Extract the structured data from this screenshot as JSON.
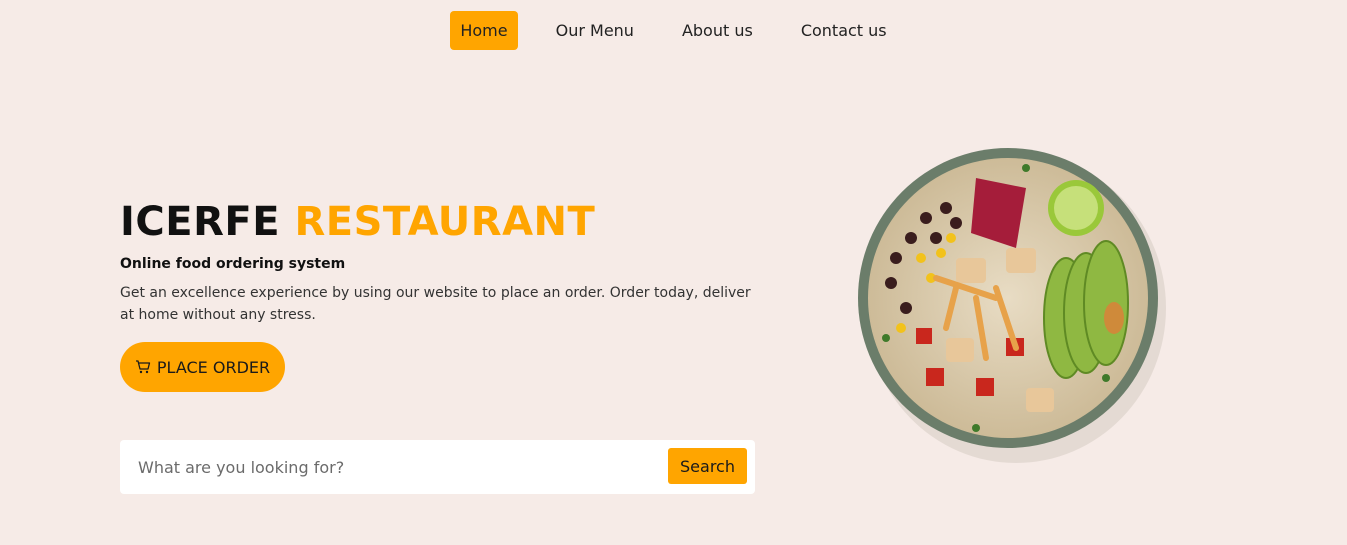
{
  "nav": {
    "items": [
      {
        "label": "Home",
        "active": true
      },
      {
        "label": "Our Menu",
        "active": false
      },
      {
        "label": "About us",
        "active": false
      },
      {
        "label": "Contact us",
        "active": false
      }
    ]
  },
  "hero": {
    "title_main": "ICERFE",
    "title_accent": "RESTAURANT",
    "subtitle": "Online food ordering system",
    "description": "Get an excellence experience by using our website to place an order. Order today, deliver at home without any stress.",
    "order_button": {
      "label": "PLACE ORDER",
      "icon": "cart-icon"
    }
  },
  "search": {
    "placeholder": "What are you looking for?",
    "value": "",
    "button_label": "Search"
  },
  "image": {
    "subject": "food-bowl"
  },
  "colors": {
    "accent": "#ffa500",
    "background": "#f6ebe7"
  }
}
